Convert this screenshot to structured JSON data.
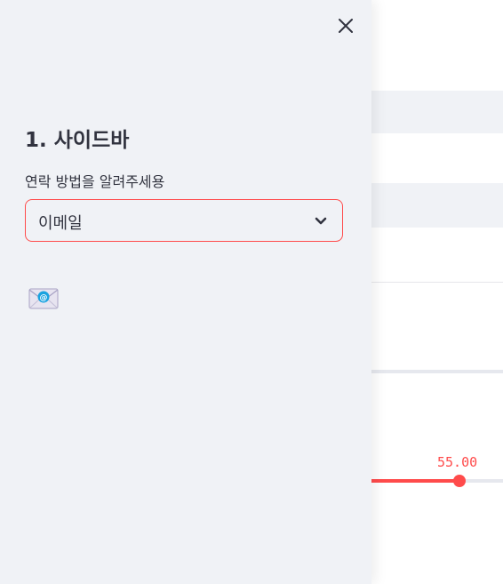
{
  "sidebar": {
    "title": "1. 사이드바",
    "select_label": "연락 방법을 알려주세용",
    "select_value": "이메일",
    "emoji_icon": "envelope-with-at-icon"
  },
  "main": {
    "slider": {
      "value_label": "55.00",
      "fill_fraction": 0.55
    }
  },
  "colors": {
    "accent": "#ff4b4b",
    "sidebar_bg": "#f0f2f6",
    "text": "#31333f"
  }
}
